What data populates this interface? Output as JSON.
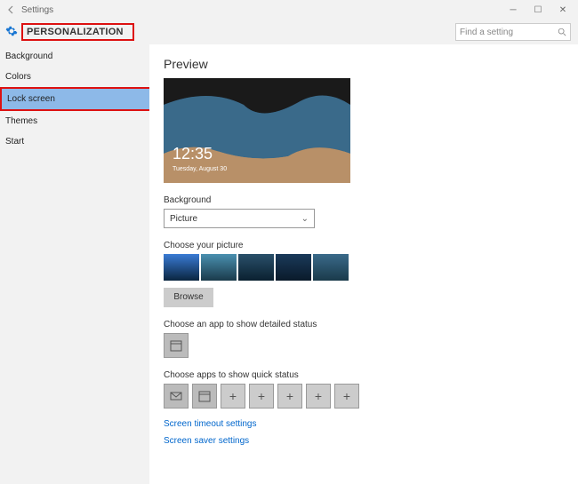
{
  "window": {
    "title": "Settings",
    "search_placeholder": "Find a setting"
  },
  "header": {
    "category": "PERSONALIZATION"
  },
  "sidebar": {
    "items": [
      {
        "label": "Background"
      },
      {
        "label": "Colors"
      },
      {
        "label": "Lock screen",
        "selected": true
      },
      {
        "label": "Themes"
      },
      {
        "label": "Start"
      }
    ]
  },
  "main": {
    "preview_heading": "Preview",
    "clock": "12:35",
    "date": "Tuesday, August 30",
    "background_label": "Background",
    "background_value": "Picture",
    "choose_picture_label": "Choose your picture",
    "browse_label": "Browse",
    "detailed_status_label": "Choose an app to show detailed status",
    "quick_status_label": "Choose apps to show quick status",
    "link_timeout": "Screen timeout settings",
    "link_saver": "Screen saver settings"
  }
}
